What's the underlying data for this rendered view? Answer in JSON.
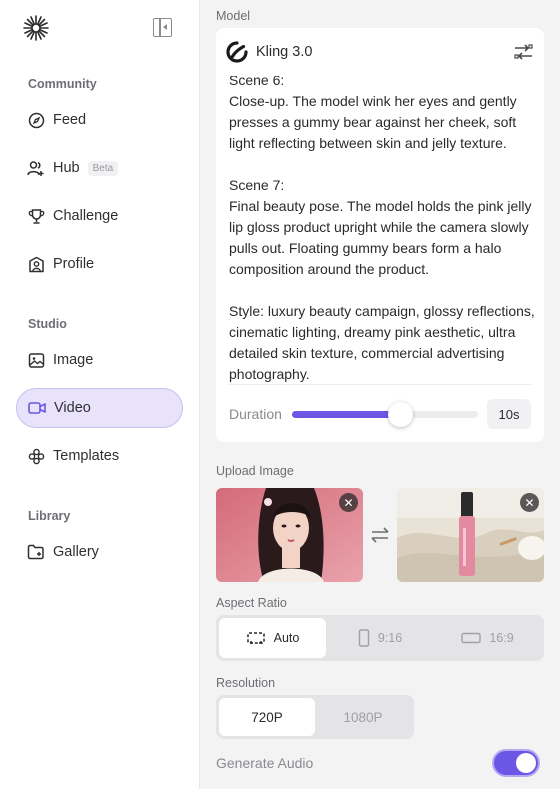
{
  "sidebar": {
    "sections": {
      "community": "Community",
      "studio": "Studio",
      "library": "Library"
    },
    "items": {
      "feed": "Feed",
      "hub": "Hub",
      "hub_badge": "Beta",
      "challenge": "Challenge",
      "profile": "Profile",
      "image": "Image",
      "video": "Video",
      "templates": "Templates",
      "gallery": "Gallery"
    },
    "active_item": "Video"
  },
  "main": {
    "model_label": "Model",
    "model_name": "Kling 3.0",
    "prompt_text": "Scene 6:\nClose-up. The model wink her eyes and gently presses a gummy bear against her cheek, soft light reflecting between skin and jelly texture.\n\nScene 7:\nFinal beauty pose. The model holds the pink jelly lip gloss product upright while the camera slowly pulls out. Floating gummy bears form a halo composition around the product.\n\nStyle: luxury beauty campaign, glossy reflections, cinematic lighting, dreamy pink aesthetic, ultra detailed skin texture, commercial advertising photography.",
    "duration_label": "Duration",
    "duration_value": "10s",
    "duration_fraction": 0.58,
    "upload_label": "Upload Image",
    "aspect_ratio_label": "Aspect Ratio",
    "aspect_options": [
      "Auto",
      "9:16",
      "16:9"
    ],
    "aspect_selected": "Auto",
    "resolution_label": "Resolution",
    "resolution_options": [
      "720P",
      "1080P"
    ],
    "resolution_selected": "720P",
    "generate_audio_label": "Generate Audio",
    "generate_audio_on": true
  },
  "colors": {
    "accent": "#6c56e6",
    "active_nav_bg": "#e8e2fb"
  }
}
